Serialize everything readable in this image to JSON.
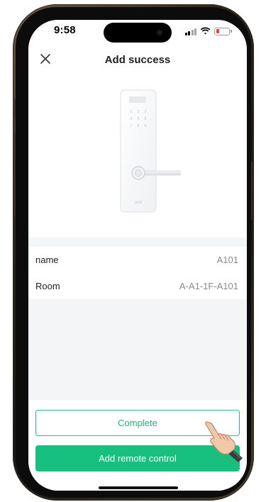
{
  "status_bar": {
    "time": "9:58",
    "icons": [
      "signal-icon",
      "wifi-icon",
      "battery-icon"
    ],
    "battery_color": "#ff3b30"
  },
  "nav": {
    "title": "Add success",
    "close_icon": "close-icon"
  },
  "device_image": {
    "icon": "smart-lock-icon",
    "keypad": [
      [
        "1",
        "2",
        "3"
      ],
      [
        "4",
        "5",
        "6"
      ],
      [
        "7",
        "8",
        "9"
      ]
    ],
    "brand_text": "LOCK"
  },
  "details": [
    {
      "label": "name",
      "value": "A101"
    },
    {
      "label": "Room",
      "value": "A-A1-1F-A101"
    }
  ],
  "actions": {
    "complete_label": "Complete",
    "add_remote_label": "Add remote control"
  },
  "colors": {
    "accent": "#17c07f",
    "accent_border": "#2bbd86",
    "background": "#f4f5f7"
  },
  "overlay": {
    "icon": "pointing-hand-icon"
  }
}
